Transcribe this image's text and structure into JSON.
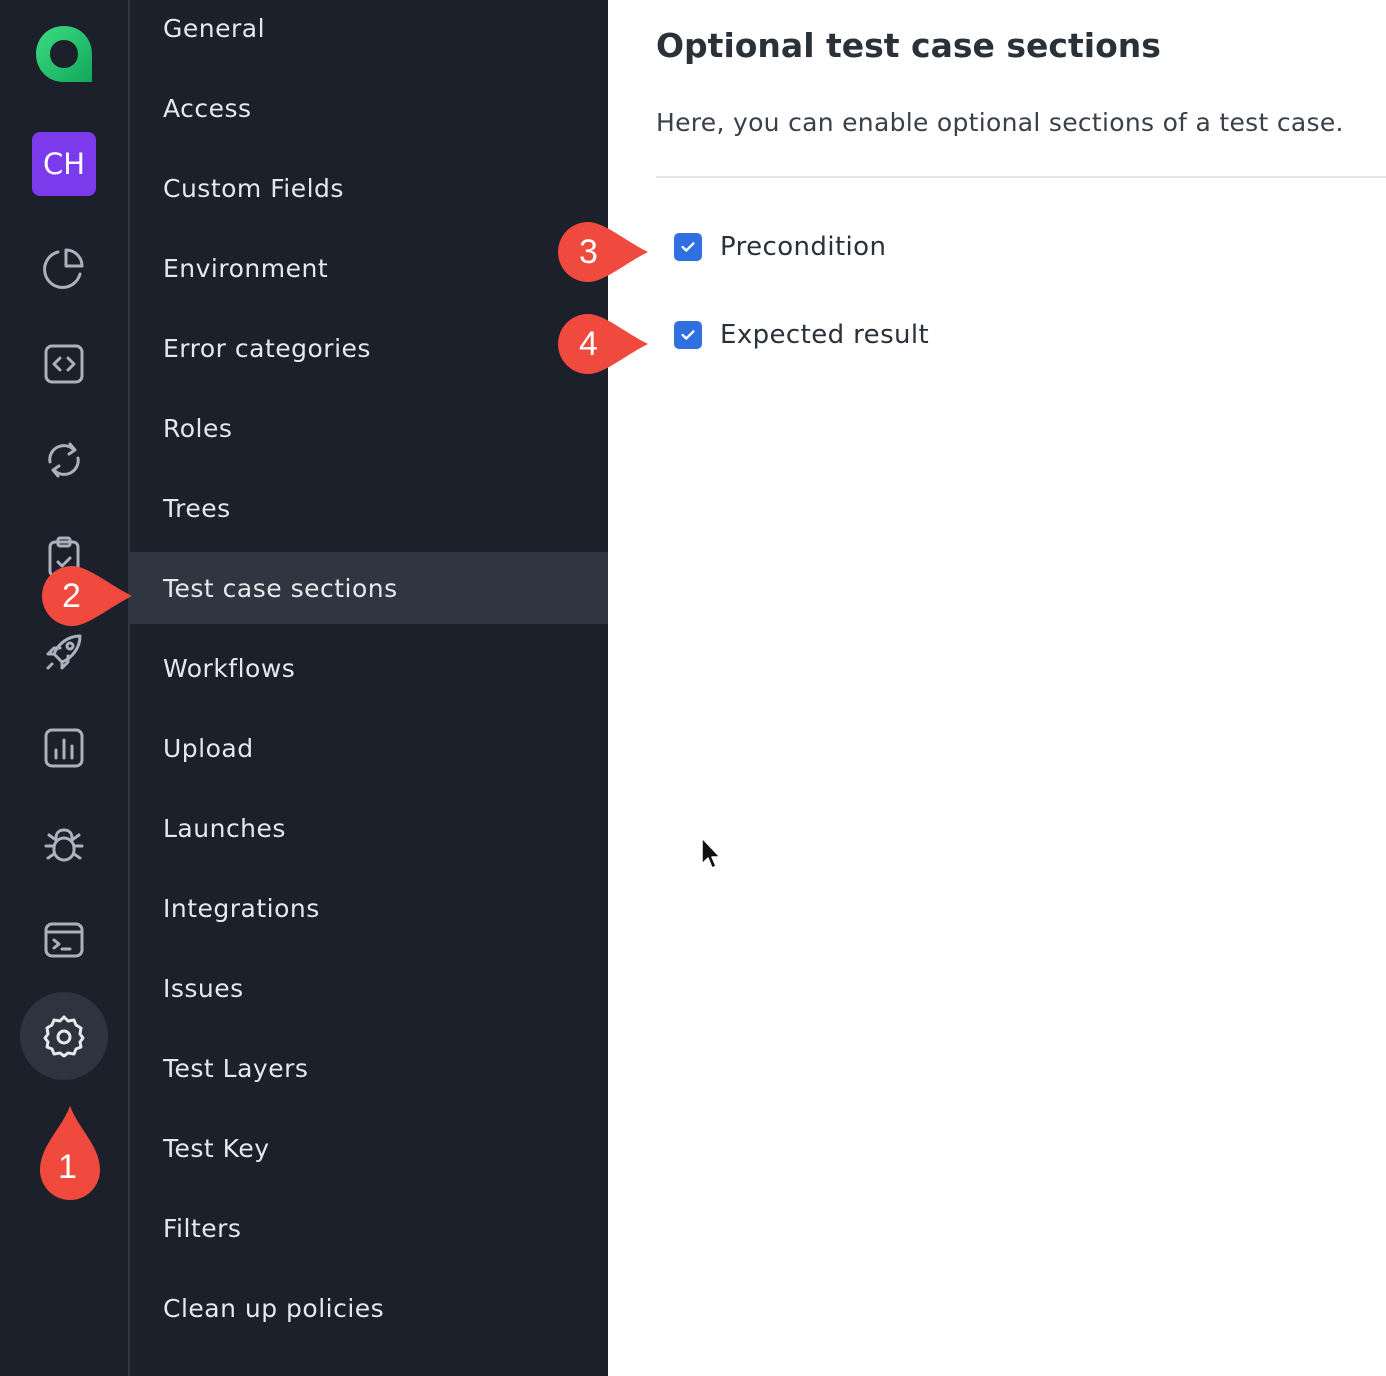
{
  "rail": {
    "logo_icon": "app-logo",
    "avatar_initials": "CH",
    "icons": [
      "pie-chart-icon",
      "code-icon",
      "sync-icon",
      "clipboard-check-icon",
      "rocket-icon",
      "bar-chart-icon",
      "bug-icon",
      "terminal-icon",
      "gear-icon"
    ]
  },
  "menu": {
    "items": [
      {
        "label": "General"
      },
      {
        "label": "Access"
      },
      {
        "label": "Custom Fields"
      },
      {
        "label": "Environment"
      },
      {
        "label": "Error categories"
      },
      {
        "label": "Roles"
      },
      {
        "label": "Trees"
      },
      {
        "label": "Test case sections"
      },
      {
        "label": "Workflows"
      },
      {
        "label": "Upload"
      },
      {
        "label": "Launches"
      },
      {
        "label": "Integrations"
      },
      {
        "label": "Issues"
      },
      {
        "label": "Test Layers"
      },
      {
        "label": "Test Key"
      },
      {
        "label": "Filters"
      },
      {
        "label": "Clean up policies"
      }
    ],
    "active": "Test case sections"
  },
  "main": {
    "title": "Optional test case sections",
    "description": "Here, you can enable optional sections of a test case.",
    "options": [
      {
        "label": "Precondition",
        "checked": true
      },
      {
        "label": "Expected result",
        "checked": true
      }
    ]
  },
  "callouts": {
    "one": "1",
    "two": "2",
    "three": "3",
    "four": "4"
  },
  "colors": {
    "sidebar_bg": "#1b202a",
    "active_item_bg": "#2f3642",
    "accent_checkbox": "#2f6fe0",
    "avatar_bg": "#7c3aed",
    "logo_green": "#1fbf6a",
    "callout_red": "#f04a3e"
  }
}
